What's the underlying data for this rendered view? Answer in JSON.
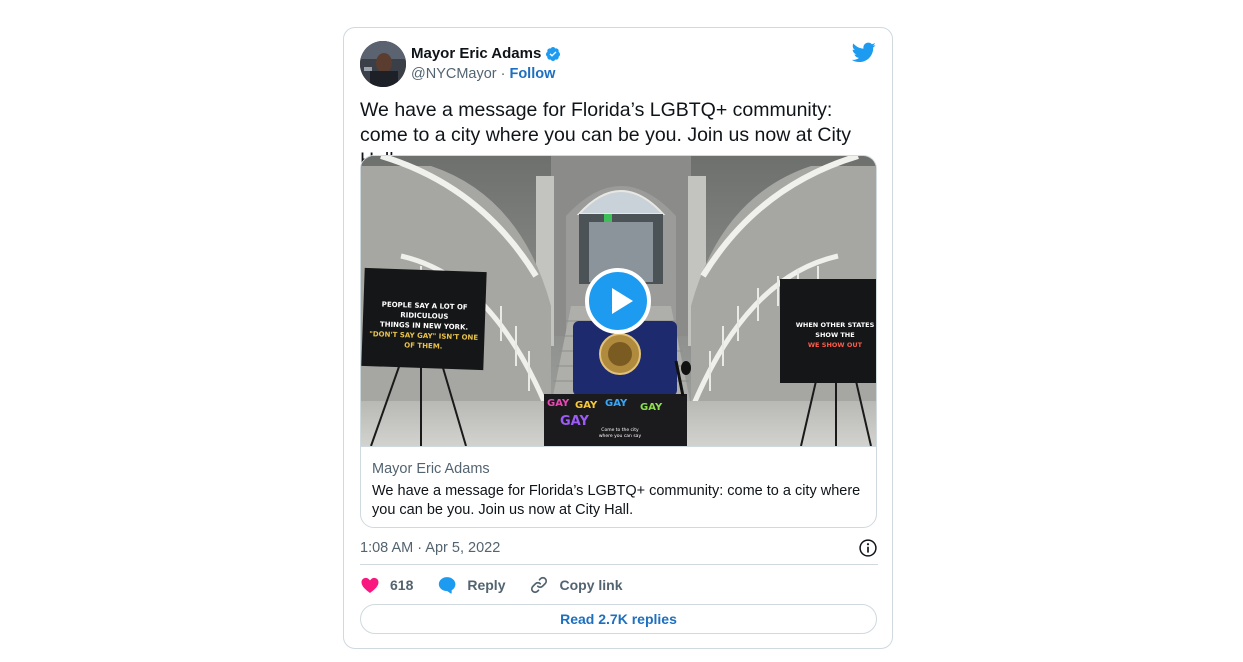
{
  "author": {
    "display_name": "Mayor Eric Adams",
    "handle": "@NYCMayor",
    "separator": "·",
    "follow_label": "Follow"
  },
  "tweet": {
    "text": "We have a message for Florida’s LGBTQ+ community: come to a city where you can be you. Join us now at City Hall.",
    "timestamp": "1:08 AM · Apr 5, 2022"
  },
  "media_card": {
    "author": "Mayor Eric Adams",
    "text": "We have a message for Florida’s LGBTQ+ community: come to a city where you can be you. Join us now at City Hall.",
    "sign_left": [
      "PEOPLE SAY A LOT OF RIDICULOUS",
      "THINGS IN NEW YORK.",
      "\"DON'T SAY GAY\" ISN'T ONE OF THEM."
    ],
    "sign_right": [
      "WHEN OTHER STATES SHOW THE",
      "WE SHOW OUT"
    ],
    "podium_banner": [
      "GAY",
      "GAY",
      "GAY",
      "GAY",
      "GAY"
    ],
    "podium_caption": "Come to the city where you can say"
  },
  "actions": {
    "like_count": "618",
    "reply_label": "Reply",
    "copy_link_label": "Copy link"
  },
  "read_replies_label": "Read 2.7K replies",
  "colors": {
    "accent_blue": "#1d9bf0",
    "link_blue": "#1d6fbf",
    "like_pink": "#f91880",
    "secondary_text": "#536471",
    "border": "#cfd9de"
  }
}
